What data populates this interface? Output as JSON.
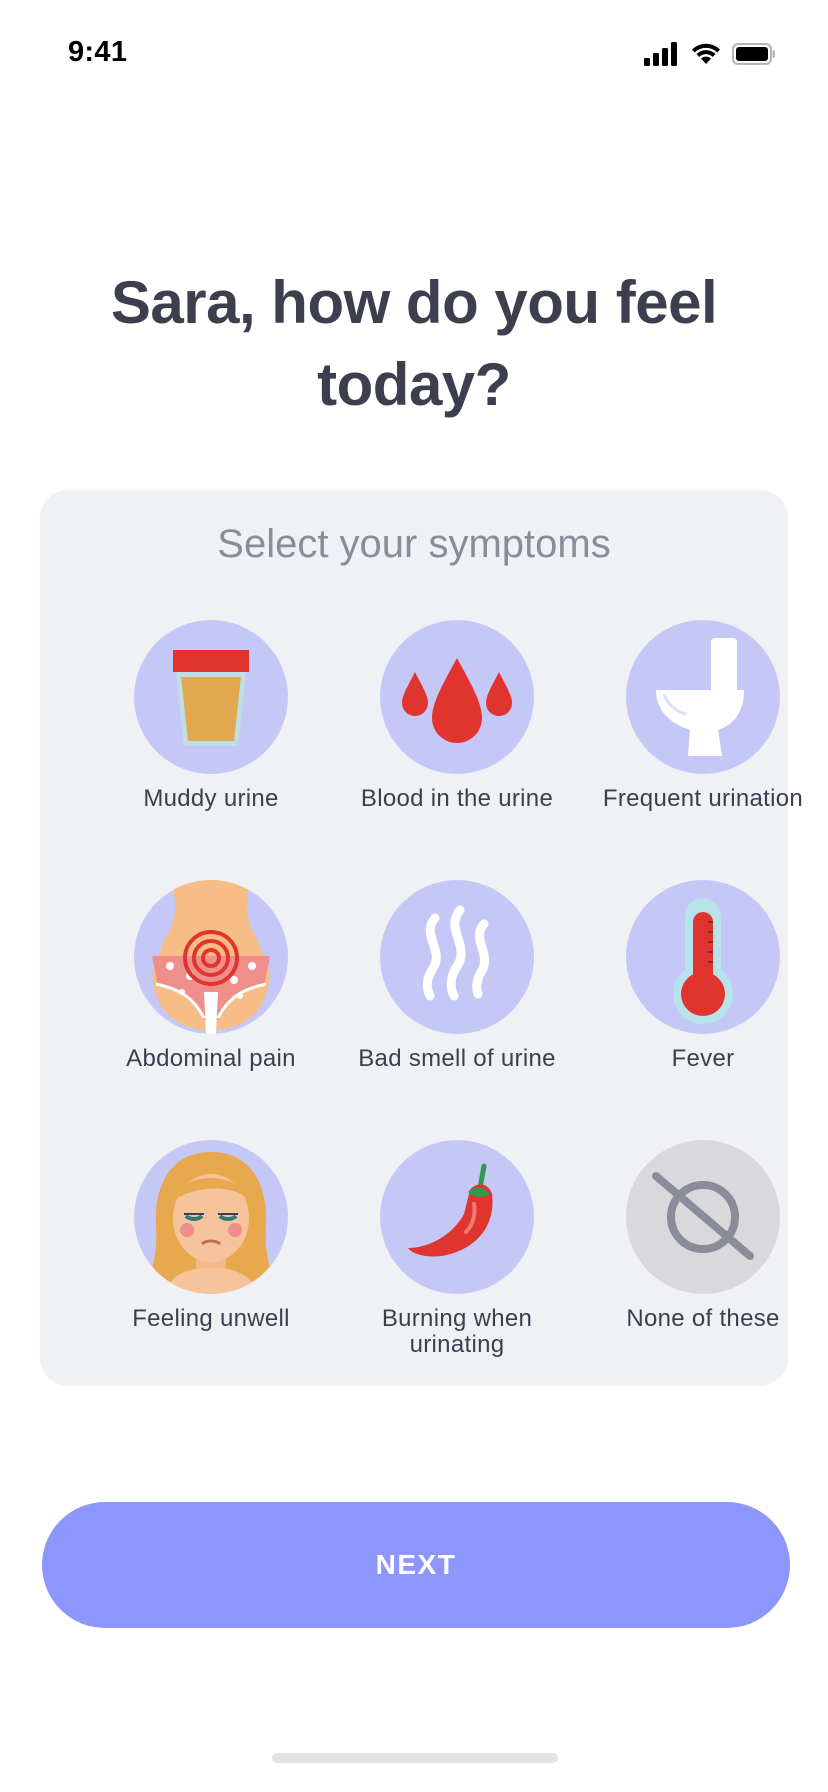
{
  "status": {
    "time": "9:41"
  },
  "title": "Sara, how do you feel today?",
  "card": {
    "title": "Select your symptoms",
    "symptoms": [
      {
        "label": "Muddy urine",
        "icon": "urine-cup-icon",
        "selected": false
      },
      {
        "label": "Blood in the urine",
        "icon": "blood-drops-icon",
        "selected": false
      },
      {
        "label": "Frequent urination",
        "icon": "toilet-icon",
        "selected": false
      },
      {
        "label": "Abdominal pain",
        "icon": "abdomen-pain-icon",
        "selected": false
      },
      {
        "label": "Bad smell of urine",
        "icon": "smell-waves-icon",
        "selected": false
      },
      {
        "label": "Fever",
        "icon": "thermometer-icon",
        "selected": false
      },
      {
        "label": "Feeling unwell",
        "icon": "unwell-face-icon",
        "selected": false
      },
      {
        "label": "Burning when urinating",
        "icon": "chili-pepper-icon",
        "selected": false
      },
      {
        "label": "None of these",
        "icon": "none-icon",
        "selected": false
      }
    ]
  },
  "next_button": {
    "label": "NEXT"
  },
  "colors": {
    "title": "#3d3f4f",
    "card_background": "#f0f1f5",
    "icon_circle": "#c5c8f7",
    "none_circle": "#d9d9dc",
    "button": "#8c96fb"
  }
}
